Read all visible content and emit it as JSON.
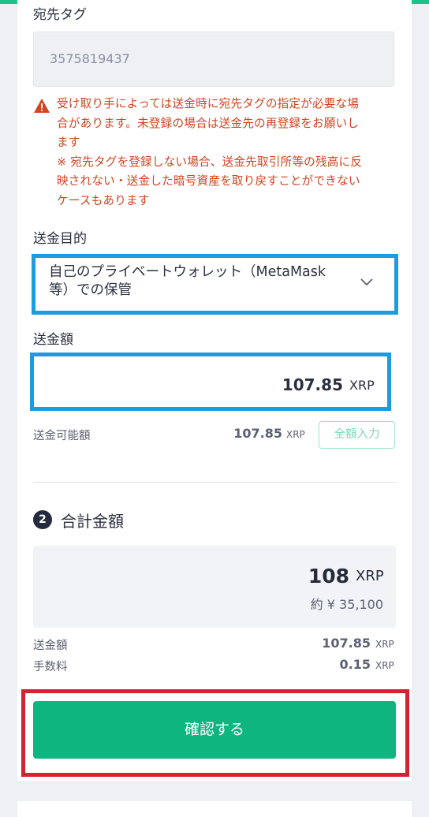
{
  "destination_tag": {
    "label": "宛先タグ",
    "value": "3575819437"
  },
  "warning": {
    "text": "受け取り手によっては送金時に宛先タグの指定が必要な場\n合があります。未登録の場合は送金先の再登録をお願いし\nます\n※ 宛先タグを登録しない場合、送金先取引所等の残高に反\n映されない・送金した暗号資産を取り戻すことができない\nケースもあります",
    "icon": "warning-triangle-icon",
    "color": "#d24320"
  },
  "purpose": {
    "label": "送金目的",
    "selected": "自己のプライベートウォレット（MetaMask\n等）での保管"
  },
  "amount": {
    "label": "送金額",
    "value": "107.85",
    "unit": "XRP",
    "available_label": "送金可能額",
    "available_value": "107.85",
    "available_unit": "XRP",
    "fill_all_button": "全額入力"
  },
  "total": {
    "step_number": "2",
    "title": "合計金額",
    "value": "108",
    "unit": "XRP",
    "jpy": "約 ¥ 35,100",
    "rows": [
      {
        "label": "送金額",
        "value": "107.85",
        "unit": "XRP"
      },
      {
        "label": "手数料",
        "value": "0.15",
        "unit": "XRP"
      }
    ]
  },
  "confirm_button": "確認する",
  "colors": {
    "accent_green": "#0eb57f",
    "highlight_blue": "#1a9de0",
    "highlight_red": "#d9222f",
    "warning_red": "#d24320"
  }
}
